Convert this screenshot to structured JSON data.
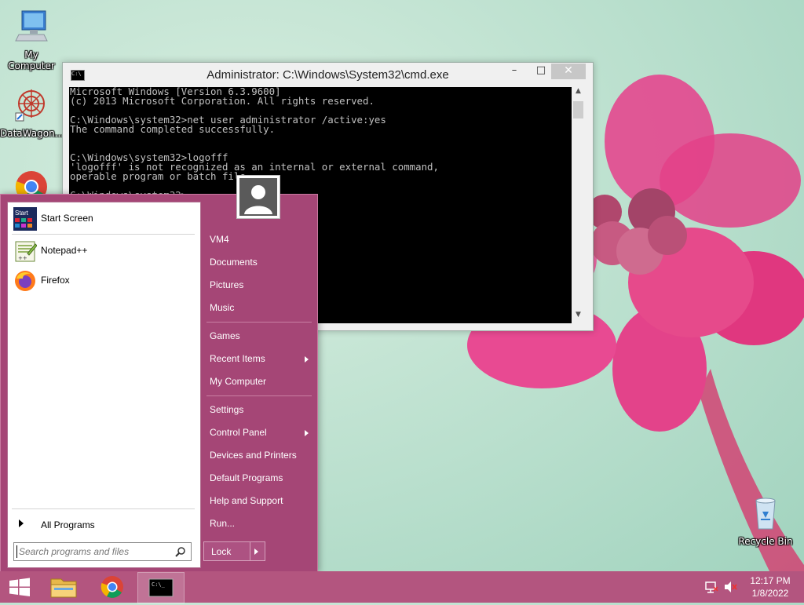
{
  "desktop": {
    "icons": [
      {
        "label": "My Computer",
        "icon": "computer-icon"
      },
      {
        "label": "DataWagon...",
        "icon": "datawagon-icon"
      },
      {
        "label": "",
        "icon": "chrome-icon"
      },
      {
        "label": "Recycle Bin",
        "icon": "recycle-bin-icon"
      }
    ]
  },
  "cmd_window": {
    "title": "Administrator: C:\\Windows\\System32\\cmd.exe",
    "lines": [
      "Microsoft Windows [Version 6.3.9600]",
      "(c) 2013 Microsoft Corporation. All rights reserved.",
      "",
      "C:\\Windows\\system32>net user administrator /active:yes",
      "The command completed successfully.",
      "",
      "",
      "C:\\Windows\\system32>logofff",
      "'logofff' is not recognized as an internal or external command,",
      "operable program or batch file.",
      "",
      "C:\\Windows\\system32>"
    ],
    "buttons": {
      "minimize": "–",
      "maximize": "□",
      "close": "✕"
    }
  },
  "start_menu": {
    "pinned": [
      {
        "label": "Start Screen",
        "icon": "start-screen-icon"
      },
      {
        "label": "Notepad++",
        "icon": "notepadpp-icon"
      },
      {
        "label": "Firefox",
        "icon": "firefox-icon"
      }
    ],
    "all_programs": "All Programs",
    "search_placeholder": "Search programs and files",
    "right_links": [
      {
        "label": "VM4",
        "submenu": false
      },
      {
        "label": "Documents",
        "submenu": false
      },
      {
        "label": "Pictures",
        "submenu": false
      },
      {
        "label": "Music",
        "submenu": false
      },
      {
        "label": "Games",
        "submenu": false
      },
      {
        "label": "Recent Items",
        "submenu": true
      },
      {
        "label": "My Computer",
        "submenu": false
      },
      {
        "label": "Settings",
        "submenu": false
      },
      {
        "label": "Control Panel",
        "submenu": true
      },
      {
        "label": "Devices and Printers",
        "submenu": false
      },
      {
        "label": "Default Programs",
        "submenu": false
      },
      {
        "label": "Help and Support",
        "submenu": false
      },
      {
        "label": "Run...",
        "submenu": false
      }
    ],
    "lock_label": "Lock",
    "start_tile_text": "Start"
  },
  "taskbar": {
    "items": [
      "windows-start-icon",
      "file-explorer-icon",
      "chrome-icon",
      "cmd-icon"
    ],
    "active_item": "cmd-icon",
    "clock_time": "12:17 PM",
    "clock_date": "1/8/2022"
  },
  "colors": {
    "accent": "#a54676",
    "taskbar": "#b3557f",
    "wallpaper": "#b9dfcd"
  }
}
